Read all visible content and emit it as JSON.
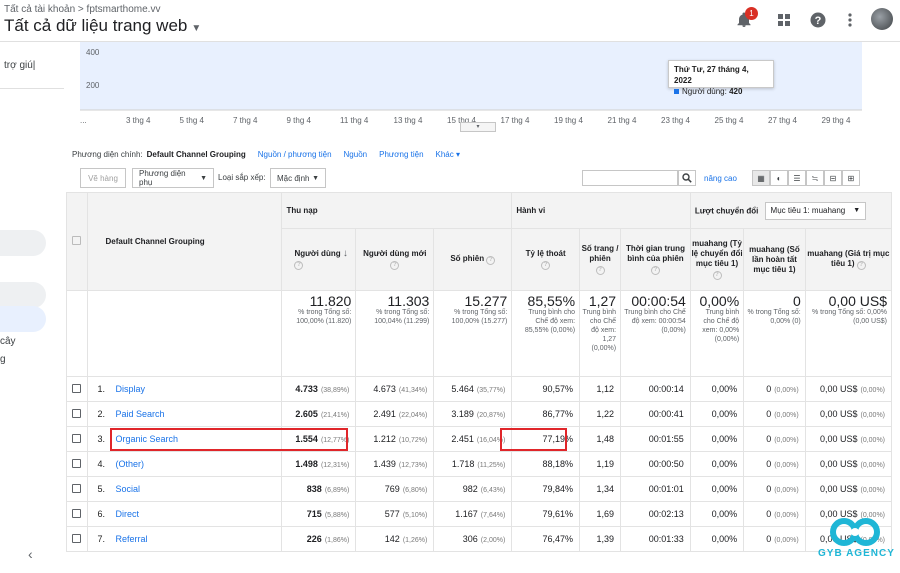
{
  "header": {
    "breadcrumb": "Tất cả tài khoản > fptsmarthome.vv",
    "title": "Tất cả dữ liệu trang web",
    "notification_count": "1"
  },
  "sidebar": {
    "items": [
      "trợ giú|",
      "cây",
      "g"
    ]
  },
  "chart_data": {
    "type": "area",
    "y_ticks": [
      "400",
      "200"
    ],
    "x_tick_labels": [
      "...",
      "3 thg 4",
      "5 thg 4",
      "7 thg 4",
      "9 thg 4",
      "11 thg 4",
      "13 thg 4",
      "15 thg 4",
      "17 thg 4",
      "19 thg 4",
      "21 thg 4",
      "23 thg 4",
      "25 thg 4",
      "27 thg 4",
      "29 thg 4"
    ],
    "series": [
      {
        "name": "Người dùng",
        "values": [
          395,
          400,
          440,
          380,
          350,
          430,
          450,
          470,
          430,
          470,
          450,
          440,
          430,
          455,
          460,
          465,
          460,
          470,
          410,
          475,
          470,
          440,
          460,
          465,
          470,
          460,
          455,
          475,
          470,
          420,
          360
        ]
      }
    ],
    "color": "#1a73e8"
  },
  "tooltip": {
    "date": "Thứ Tư, 27 tháng 4, 2022",
    "metric": "Người dùng:",
    "value": "420"
  },
  "dimensions": {
    "label": "Phương diện chính:",
    "selected": "Default Channel Grouping",
    "options": [
      "Nguồn / phương tiện",
      "Nguồn",
      "Phương tiện"
    ],
    "more": "Khác"
  },
  "toolbar": {
    "plot_rows": "Vẽ hàng",
    "secondary": "Phương diện phụ",
    "sort_label": "Loại sắp xếp:",
    "sort_value": "Mặc định",
    "advanced": "nâng cao"
  },
  "table": {
    "dimension_header": "Default Channel Grouping",
    "groups": [
      "Thu nạp",
      "Hành vi",
      "Lượt chuyển đổi"
    ],
    "goal_select": "Mục tiêu 1: muahang",
    "columns": [
      "Người dùng",
      "Người dùng mới",
      "Số phiên",
      "Tỷ lệ thoát",
      "Số trang / phiên",
      "Thời gian trung bình của phiên",
      "muahang (Tỷ lệ chuyển đổi mục tiêu 1)",
      "muahang (Số lần hoàn tất mục tiêu 1)",
      "muahang (Giá trị mục tiêu 1)"
    ],
    "totals": [
      {
        "big": "11.820",
        "note": "% trong Tổng số: 100,00% (11.820)"
      },
      {
        "big": "11.303",
        "note": "% trong Tổng số: 100,04% (11.299)"
      },
      {
        "big": "15.277",
        "note": "% trong Tổng số: 100,00% (15.277)"
      },
      {
        "big": "85,55%",
        "note": "Trung bình cho Chế độ xem: 85,55% (0,00%)"
      },
      {
        "big": "1,27",
        "note": "Trung bình cho Chế độ xem: 1,27 (0,00%)"
      },
      {
        "big": "00:00:54",
        "note": "Trung bình cho Chế độ xem: 00:00:54 (0,00%)"
      },
      {
        "big": "0,00%",
        "note": "Trung bình cho Chế độ xem: 0,00% (0,00%)"
      },
      {
        "big": "0",
        "note": "% trong Tổng số: 0,00% (0)"
      },
      {
        "big": "0,00 US$",
        "note": "% trong Tổng số: 0,00% (0,00 US$)"
      }
    ],
    "rows": [
      {
        "idx": "1.",
        "name": "Display",
        "users": "4.733",
        "users_pct": "(38,89%)",
        "new": "4.673",
        "new_pct": "(41,34%)",
        "sess": "5.464",
        "sess_pct": "(35,77%)",
        "bounce": "90,57%",
        "pps": "1,12",
        "dur": "00:00:14",
        "cr": "0,00%",
        "comp": "0",
        "comp_pct": "(0,00%)",
        "val": "0,00 US$",
        "val_pct": "(0,00%)"
      },
      {
        "idx": "2.",
        "name": "Paid Search",
        "users": "2.605",
        "users_pct": "(21,41%)",
        "new": "2.491",
        "new_pct": "(22,04%)",
        "sess": "3.189",
        "sess_pct": "(20,87%)",
        "bounce": "86,77%",
        "pps": "1,22",
        "dur": "00:00:41",
        "cr": "0,00%",
        "comp": "0",
        "comp_pct": "(0,00%)",
        "val": "0,00 US$",
        "val_pct": "(0,00%)"
      },
      {
        "idx": "3.",
        "name": "Organic Search",
        "users": "1.554",
        "users_pct": "(12,77%)",
        "new": "1.212",
        "new_pct": "(10,72%)",
        "sess": "2.451",
        "sess_pct": "(16,04%)",
        "bounce": "77,19%",
        "pps": "1,48",
        "dur": "00:01:55",
        "cr": "0,00%",
        "comp": "0",
        "comp_pct": "(0,00%)",
        "val": "0,00 US$",
        "val_pct": "(0,00%)"
      },
      {
        "idx": "4.",
        "name": "(Other)",
        "users": "1.498",
        "users_pct": "(12,31%)",
        "new": "1.439",
        "new_pct": "(12,73%)",
        "sess": "1.718",
        "sess_pct": "(11,25%)",
        "bounce": "88,18%",
        "pps": "1,19",
        "dur": "00:00:50",
        "cr": "0,00%",
        "comp": "0",
        "comp_pct": "(0,00%)",
        "val": "0,00 US$",
        "val_pct": "(0,00%)"
      },
      {
        "idx": "5.",
        "name": "Social",
        "users": "838",
        "users_pct": "(6,89%)",
        "new": "769",
        "new_pct": "(6,80%)",
        "sess": "982",
        "sess_pct": "(6,43%)",
        "bounce": "79,84%",
        "pps": "1,34",
        "dur": "00:01:01",
        "cr": "0,00%",
        "comp": "0",
        "comp_pct": "(0,00%)",
        "val": "0,00 US$",
        "val_pct": "(0,00%)"
      },
      {
        "idx": "6.",
        "name": "Direct",
        "users": "715",
        "users_pct": "(5,88%)",
        "new": "577",
        "new_pct": "(5,10%)",
        "sess": "1.167",
        "sess_pct": "(7,64%)",
        "bounce": "79,61%",
        "pps": "1,69",
        "dur": "00:02:13",
        "cr": "0,00%",
        "comp": "0",
        "comp_pct": "(0,00%)",
        "val": "0,00 US$",
        "val_pct": "(0,00%)"
      },
      {
        "idx": "7.",
        "name": "Referral",
        "users": "226",
        "users_pct": "(1,86%)",
        "new": "142",
        "new_pct": "(1,26%)",
        "sess": "306",
        "sess_pct": "(2,00%)",
        "bounce": "76,47%",
        "pps": "1,39",
        "dur": "00:01:33",
        "cr": "0,00%",
        "comp": "0",
        "comp_pct": "(0,00%)",
        "val": "0,00 US$",
        "val_pct": "(0,00%)"
      }
    ]
  },
  "watermark": {
    "text": "GYB AGENCY",
    "color": "#1fb6d6"
  }
}
